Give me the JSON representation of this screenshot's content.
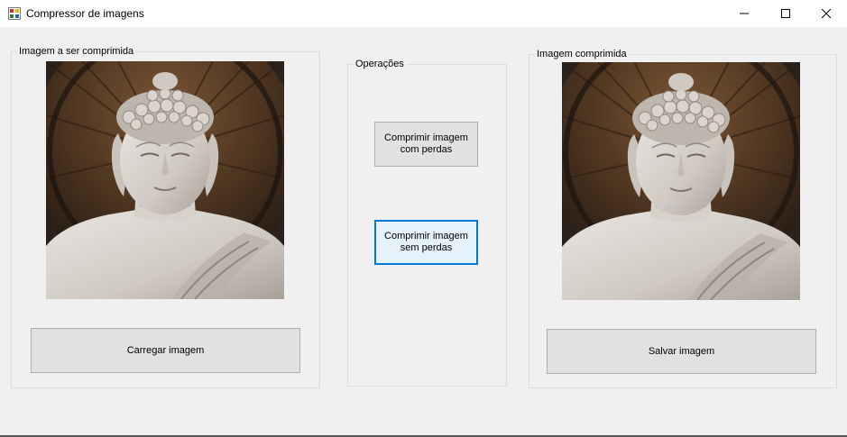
{
  "window": {
    "title": "Compressor de imagens",
    "app_icon": "windows-forms-app-icon",
    "controls": [
      "minimize-icon",
      "maximize-icon",
      "close-icon"
    ]
  },
  "left_panel": {
    "label": "Imagem a ser comprimida",
    "image": "buddha-statue-image",
    "button_label": "Carregar imagem"
  },
  "middle_panel": {
    "label": "Operações",
    "lossy_button": {
      "line1": "Comprimir imagem",
      "line2": "com perdas"
    },
    "lossless_button": {
      "line1": "Comprimir imagem",
      "line2": "sem perdas"
    }
  },
  "right_panel": {
    "label": "Imagem comprimida",
    "image": "buddha-statue-image",
    "button_label": "Salvar imagem"
  },
  "colors": {
    "window_bg": "#f0f0f0",
    "button_bg": "#e1e1e1",
    "focus_border": "#0078d7"
  }
}
